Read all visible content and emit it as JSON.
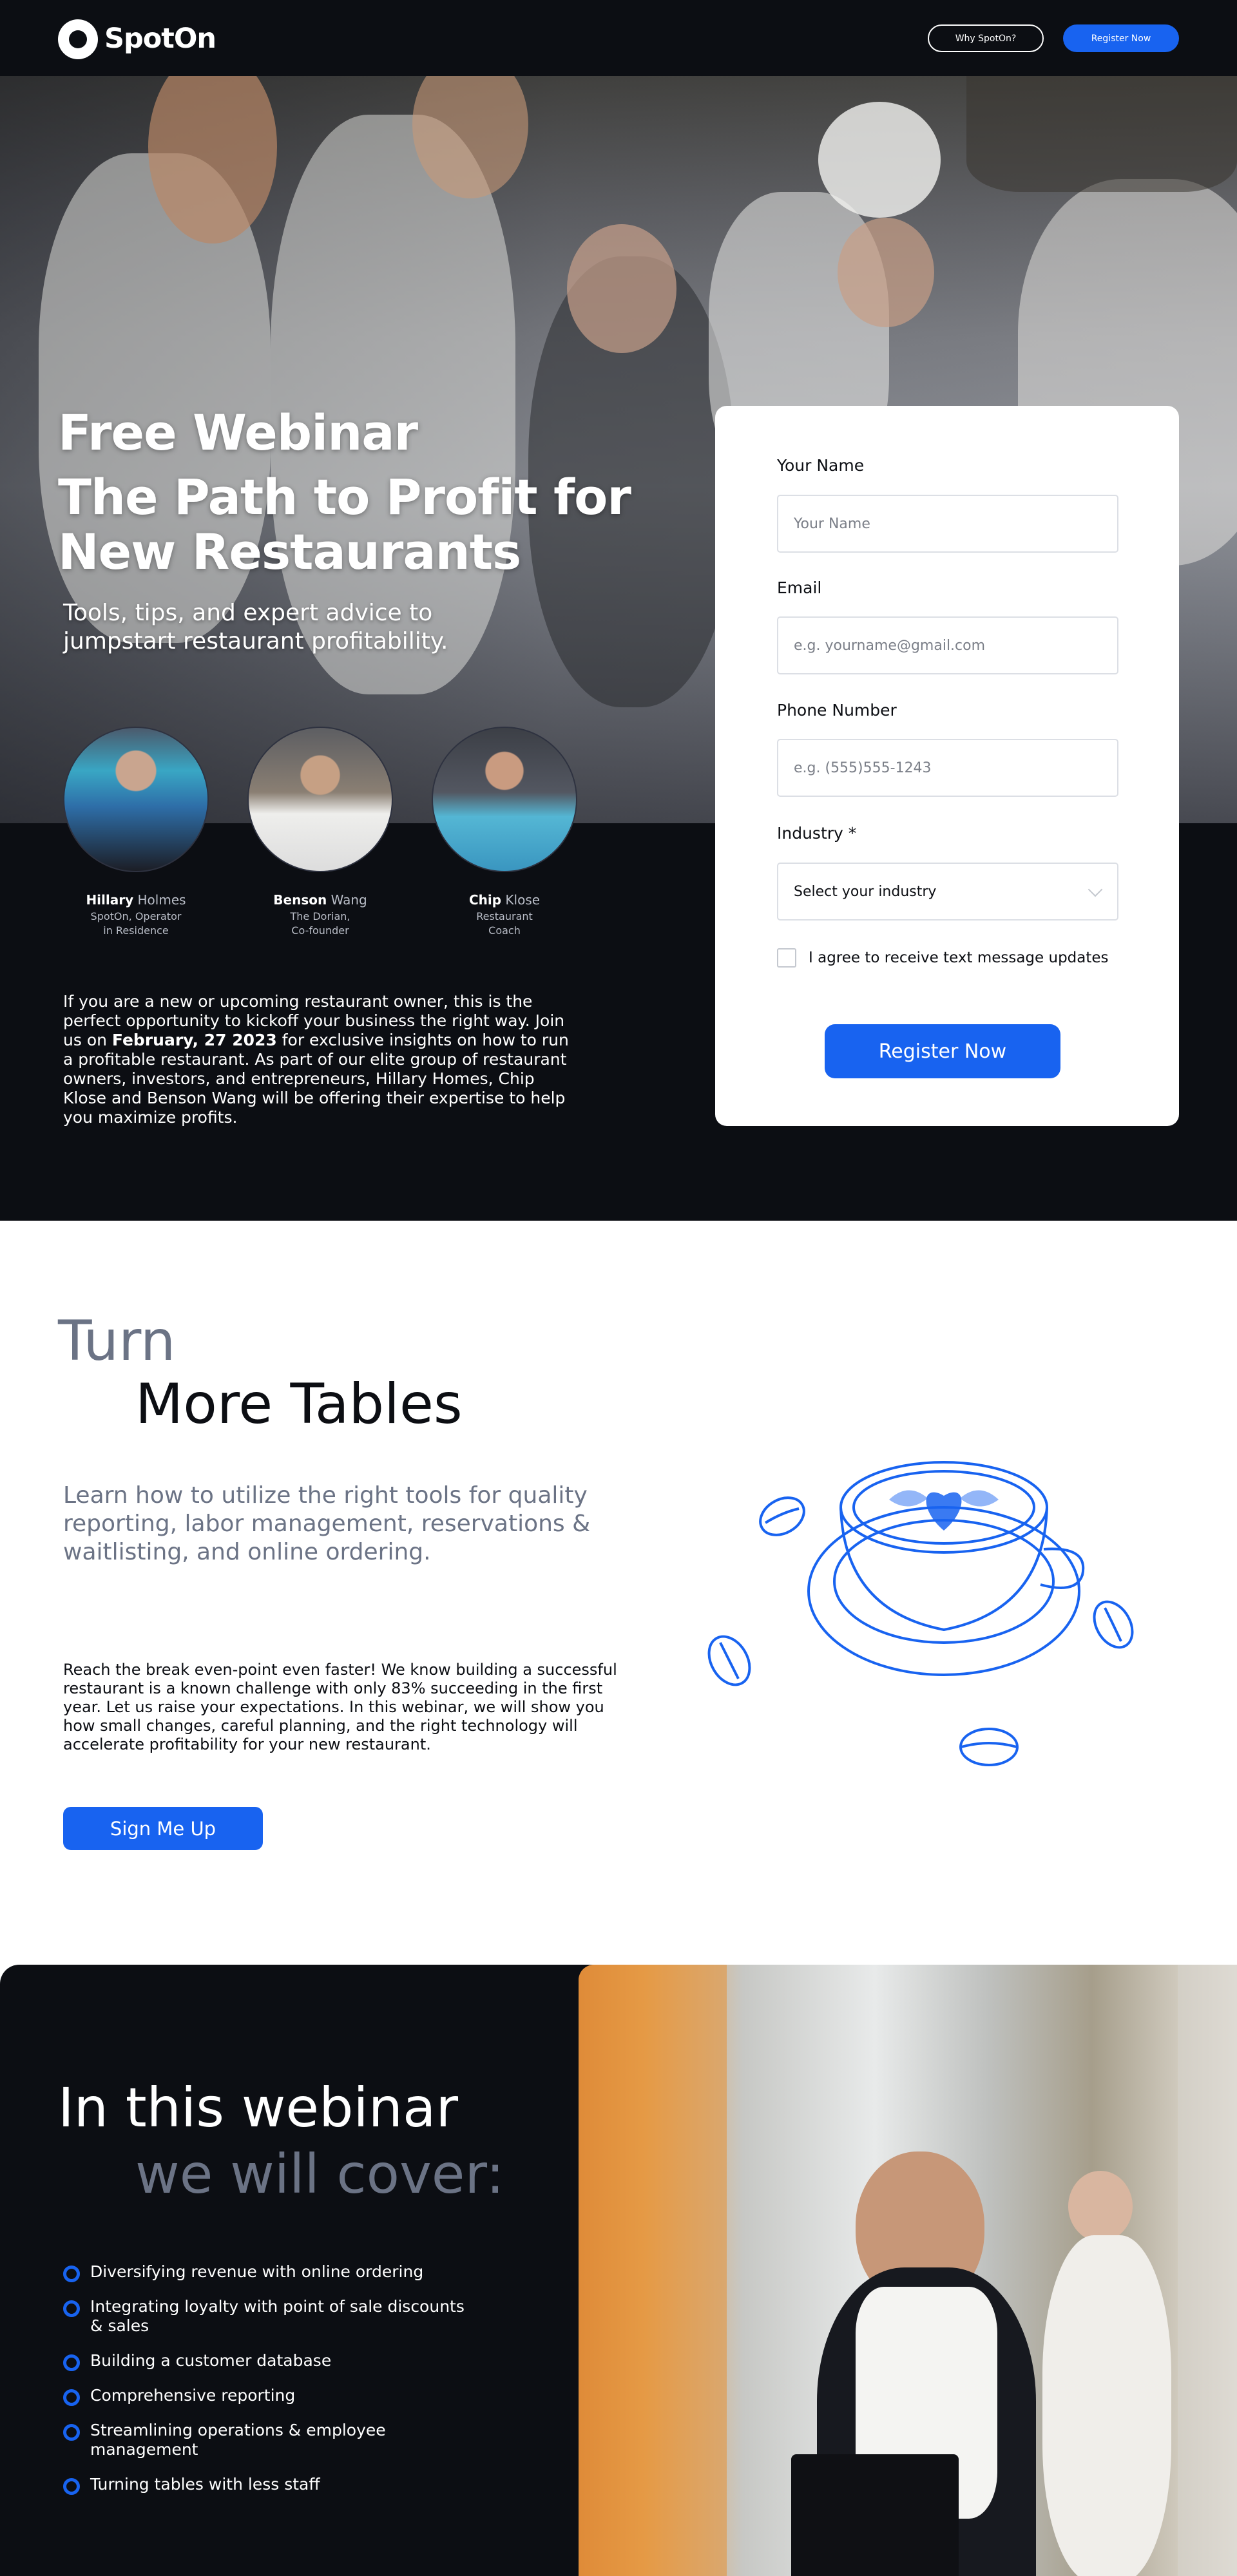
{
  "header": {
    "logo_text": "SpotOn",
    "why_label": "Why SpotOn?",
    "register_label": "Register Now"
  },
  "hero": {
    "title_line1": "Free Webinar",
    "title_line2": "The Path to Profit for",
    "title_line3": "New Restaurants",
    "subtitle": "Tools, tips, and expert advice to jumpstart restaurant profitability.",
    "speakers": [
      {
        "first": "Hillary",
        "last": "Holmes",
        "role_line1": "SpotOn, Operator",
        "role_line2": "in Residence"
      },
      {
        "first": "Benson",
        "last": "Wang",
        "role_line1": "The Dorian,",
        "role_line2": "Co-founder"
      },
      {
        "first": "Chip",
        "last": "Klose",
        "role_line1": "Restaurant",
        "role_line2": "Coach"
      }
    ],
    "body_part1": "If you are a new or upcoming restaurant owner, this is the perfect opportunity to kickoff your business the right way. Join us on ",
    "body_date": "February, 27 2023",
    "body_part2": " for exclusive insights on how to run a profitable restaurant.  As part of our elite group of restaurant owners, investors, and entrepreneurs, Hillary Homes, Chip Klose and Benson Wang will be offering their expertise to help you maximize profits."
  },
  "form": {
    "name_label": "Your Name",
    "name_placeholder": "Your Name",
    "email_label": "Email",
    "email_placeholder": "e.g. yourname@gmail.com",
    "phone_label": "Phone Number",
    "phone_placeholder": "e.g. (555)555-1243",
    "industry_label": "Industry *",
    "industry_value": "Select your industry",
    "sms_label": "I agree to receive text message updates",
    "submit_label": "Register Now"
  },
  "turn": {
    "title_line1": "Turn",
    "title_line2": "More Tables",
    "lead": "Learn how to utilize the right tools for quality reporting, labor management, reservations & waitlisting, and online ordering.",
    "body": "Reach the break even-point even faster! We know building a successful restaurant is a known challenge with only 83% succeeding in the first year. Let us raise your expectations. In this webinar, we will show you how small changes, careful planning, and the right technology will accelerate profitability for your new restaurant.",
    "cta_label": "Sign Me Up"
  },
  "cover": {
    "title_line1": "In this webinar",
    "title_line2": "we will cover:",
    "items": [
      "Diversifying revenue with online ordering",
      "Integrating loyalty with point of sale discounts & sales",
      "Building a customer database",
      "Comprehensive reporting",
      "Streamlining operations & employee management",
      "Turning tables with less staff"
    ]
  },
  "colors": {
    "accent": "#1863f0",
    "dark": "#0c0e13",
    "muted": "#6b7385"
  }
}
